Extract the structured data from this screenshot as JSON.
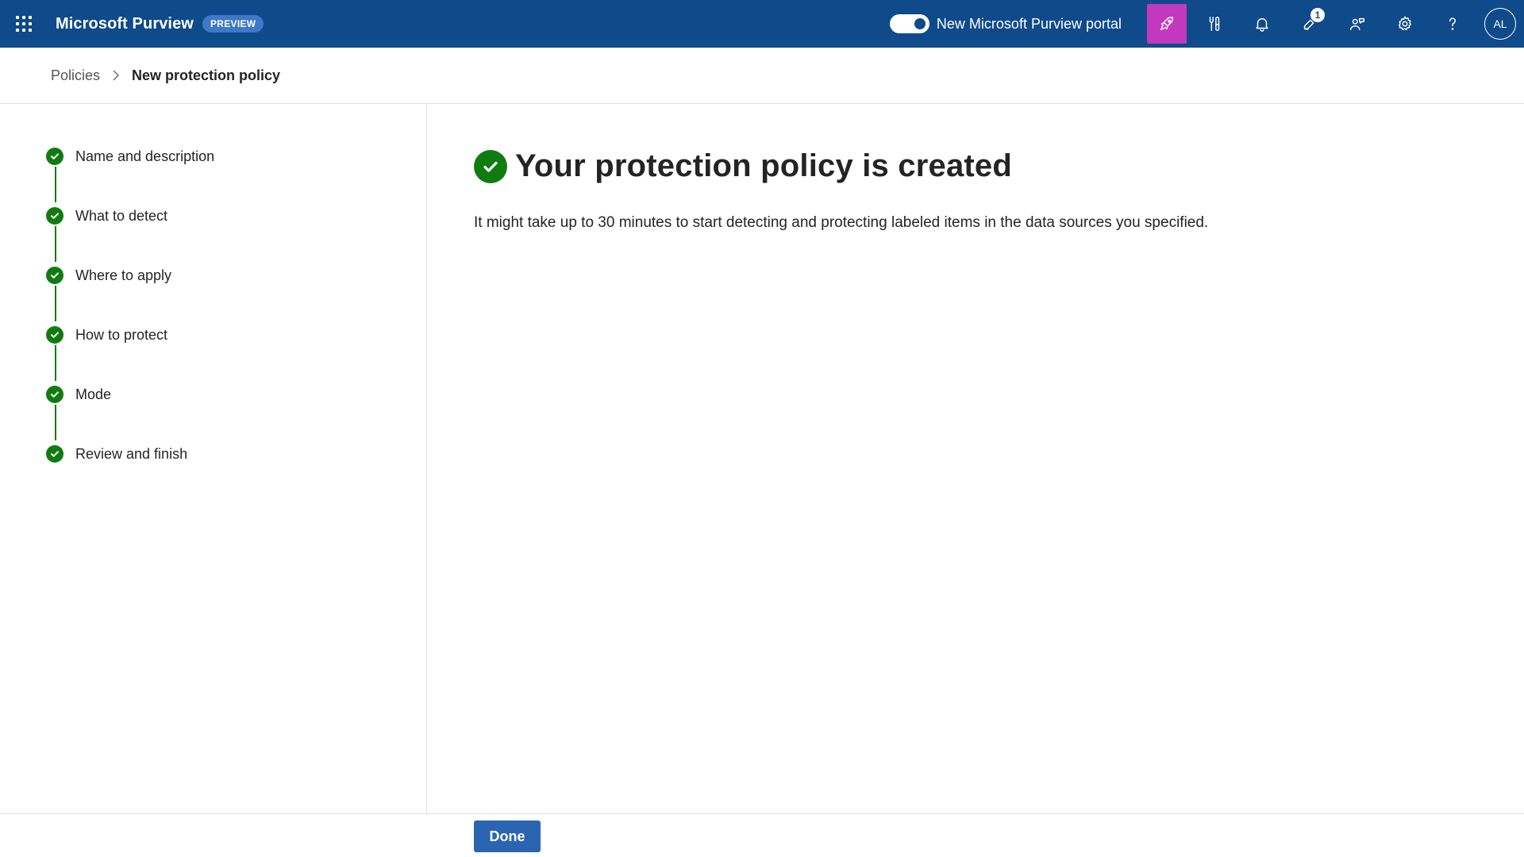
{
  "header": {
    "app_title": "Microsoft Purview",
    "badge": "PREVIEW",
    "toggle_label": "New Microsoft Purview portal",
    "notification_count": "1",
    "avatar_initials": "AL",
    "icons": [
      "app-launcher-icon",
      "copilot-rocket-icon",
      "tools-icon",
      "bell-icon",
      "whats-new-icon",
      "feedback-icon",
      "gear-icon",
      "help-icon"
    ]
  },
  "breadcrumb": {
    "parent": "Policies",
    "current": "New protection policy"
  },
  "steps": [
    {
      "label": "Name and description"
    },
    {
      "label": "What to detect"
    },
    {
      "label": "Where to apply"
    },
    {
      "label": "How to protect"
    },
    {
      "label": "Mode"
    },
    {
      "label": "Review and finish"
    }
  ],
  "main": {
    "title": "Your protection policy is created",
    "description": "It might take up to 30 minutes to start detecting and protecting labeled items in the data sources you specified."
  },
  "footer": {
    "done_label": "Done"
  },
  "colors": {
    "header_bg": "#0f4a8a",
    "active_icon_bg": "#c339bd",
    "success_green": "#107c10",
    "primary_button": "#2b64b0"
  }
}
